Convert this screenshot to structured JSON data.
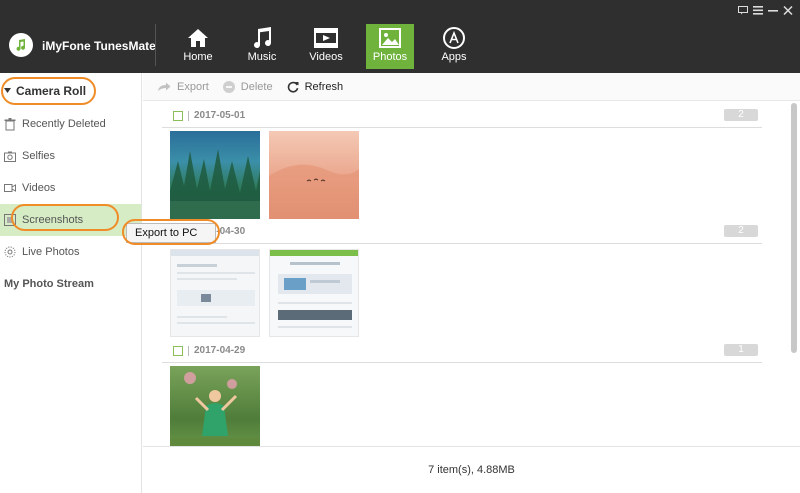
{
  "app": {
    "title": "iMyFone TunesMate"
  },
  "nav": [
    {
      "label": "Home",
      "icon": "home-icon"
    },
    {
      "label": "Music",
      "icon": "music-icon"
    },
    {
      "label": "Videos",
      "icon": "videos-icon"
    },
    {
      "label": "Photos",
      "icon": "photos-icon",
      "active": true
    },
    {
      "label": "Apps",
      "icon": "apps-icon"
    }
  ],
  "sidebar": {
    "items": [
      {
        "label": "Camera Roll",
        "icon": "triangle-down-icon"
      },
      {
        "label": "Recently Deleted",
        "icon": "trash-icon"
      },
      {
        "label": "Selfies",
        "icon": "camera-icon"
      },
      {
        "label": "Videos",
        "icon": "video-icon"
      },
      {
        "label": "Screenshots",
        "icon": "screenshot-icon"
      },
      {
        "label": "Live Photos",
        "icon": "live-photo-icon"
      },
      {
        "label": "My Photo Stream"
      }
    ]
  },
  "toolbar": {
    "export": "Export",
    "delete": "Delete",
    "refresh": "Refresh"
  },
  "groups": [
    {
      "date": "2017-05-01",
      "count": "2"
    },
    {
      "date": "2017-04-30",
      "count": "2"
    },
    {
      "date": "2017-04-29",
      "count": "1"
    }
  ],
  "context_menu": {
    "export_to_pc": "Export to PC"
  },
  "status": {
    "summary": "7 item(s), 4.88MB"
  },
  "colors": {
    "accent": "#6fb33c",
    "topbar": "#2f2f2f",
    "highlight_ring": "#f08c28"
  }
}
